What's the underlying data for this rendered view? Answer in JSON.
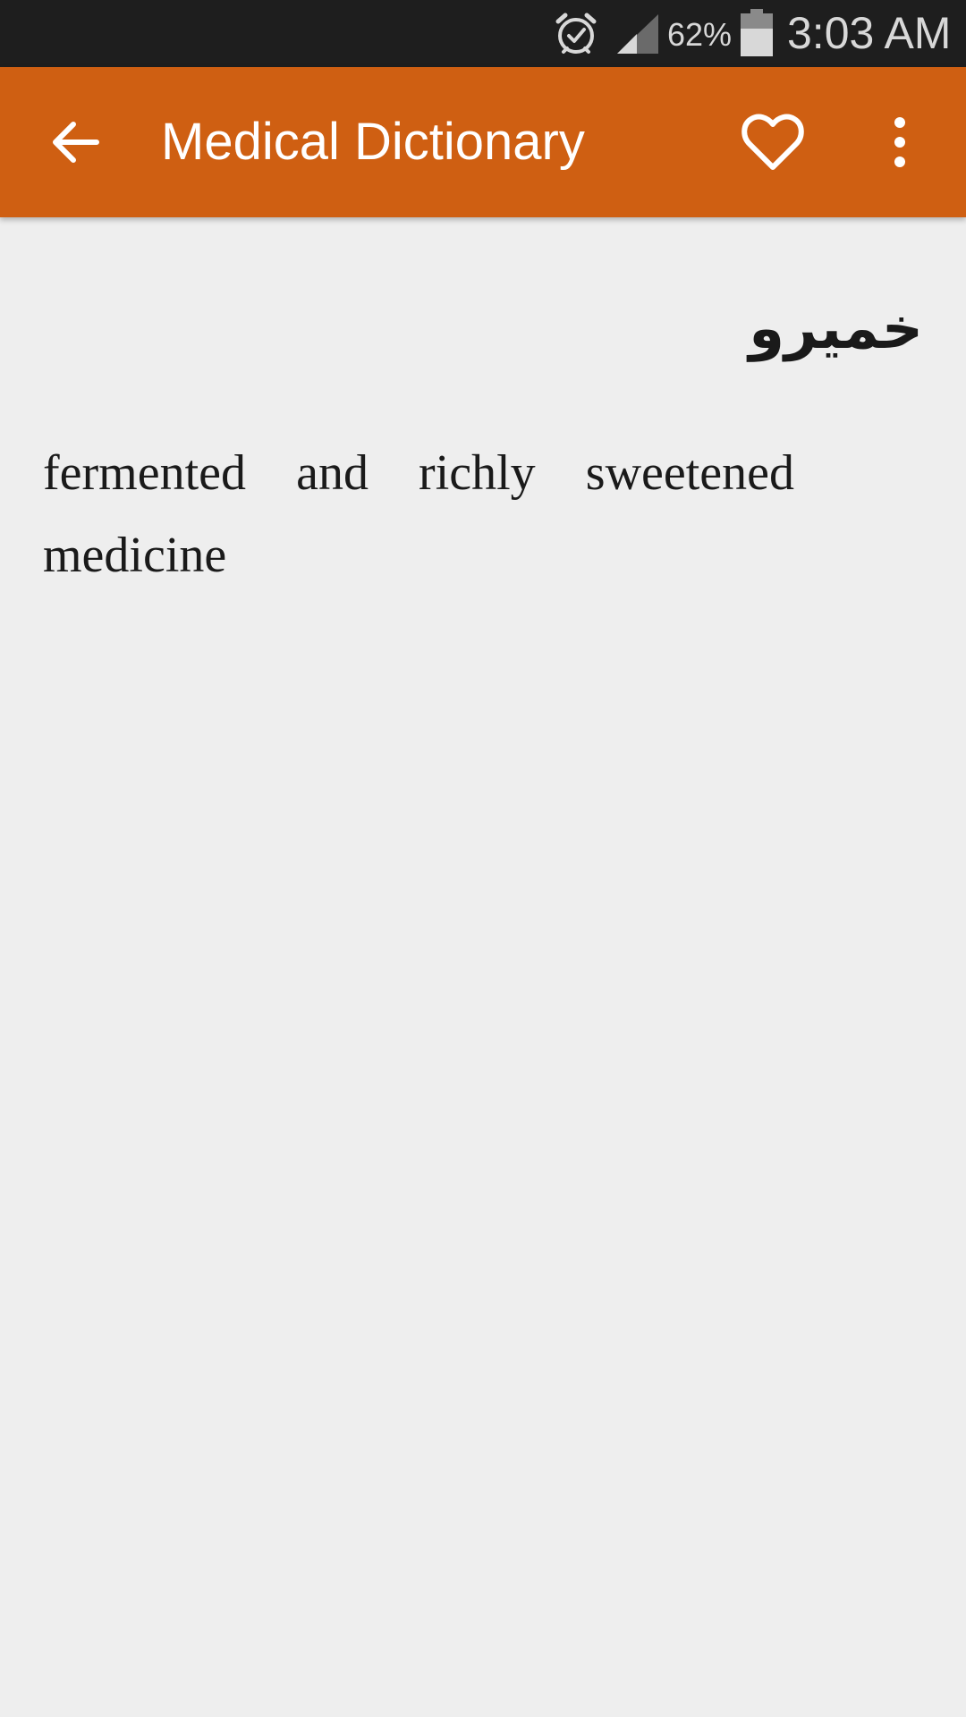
{
  "status_bar": {
    "battery_percent": "62%",
    "time": "3:03 AM",
    "icons": [
      "alarm-icon",
      "signal-icon",
      "battery-icon"
    ]
  },
  "app_bar": {
    "title": "Medical Dictionary",
    "background": "#cf5f12",
    "icons": [
      "back-arrow-icon",
      "heart-icon",
      "more-vert-icon"
    ]
  },
  "entry": {
    "term": "خمیرو",
    "definition": "fermented and richly sweetened medicine"
  }
}
